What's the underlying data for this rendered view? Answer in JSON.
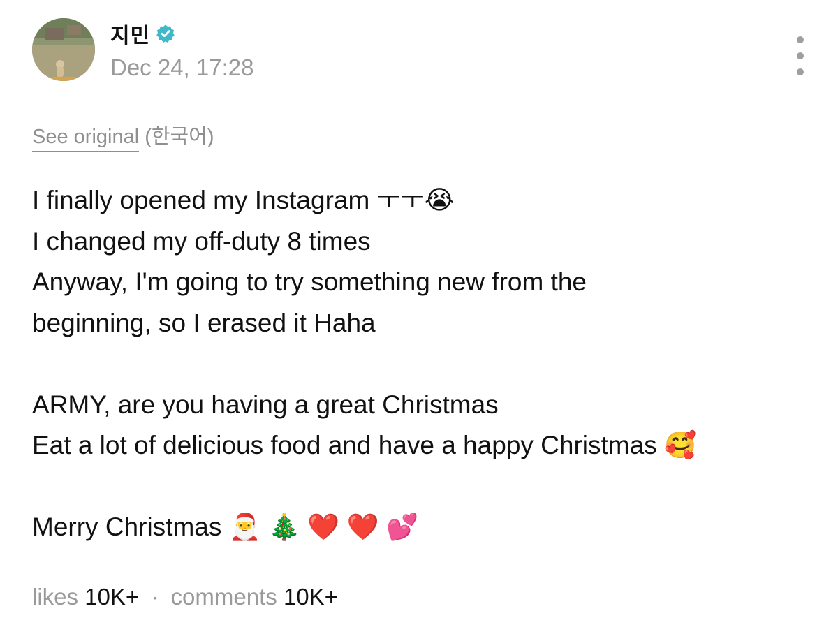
{
  "post": {
    "author": {
      "name": "지민",
      "verified": true,
      "verified_color": "#3fb8c9"
    },
    "timestamp": "Dec 24, 17:28",
    "see_original": {
      "link": "See original",
      "language": "(한국어)"
    },
    "body_lines": [
      "I finally opened my Instagram ㅜㅜ😭",
      "I changed my off-duty 8 times",
      "Anyway, I'm going to try something new from the",
      "beginning, so I erased it Haha",
      "",
      "ARMY, are you having a great Christmas",
      "Eat a lot of delicious food and have a happy Christmas 🥰",
      "",
      "Merry Christmas 🎅 🎄 ❤️ ❤️ 💕"
    ],
    "stats": {
      "likes_label": "likes",
      "likes_value": "10K+",
      "separator": "·",
      "comments_label": "comments",
      "comments_value": "10K+"
    },
    "icons": {
      "avatar": "avatar-photo",
      "verified": "verified-badge-icon",
      "more": "more-vertical-icon"
    },
    "colors": {
      "muted_text": "#9a9a9a",
      "body_text": "#111111"
    }
  }
}
